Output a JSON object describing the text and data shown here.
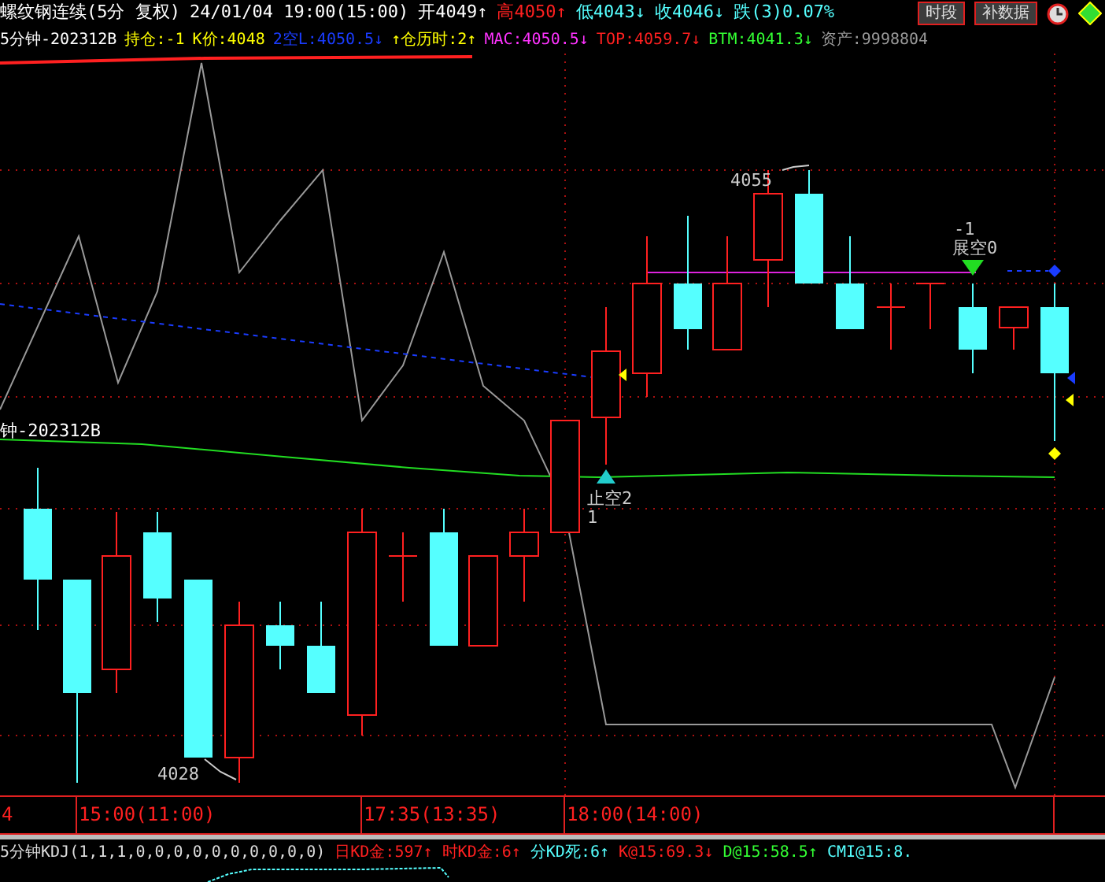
{
  "header": {
    "title": "螺纹钢连续(5分 复权)",
    "datetime": "24/01/04 19:00(15:00)",
    "quotes": [
      {
        "text": "开4049↑",
        "color": "#ffffff"
      },
      {
        "text": "高4050↑",
        "color": "#ff2020"
      },
      {
        "text": "低4043↓",
        "color": "#55ffff"
      },
      {
        "text": "收4046↓",
        "color": "#55ffff"
      },
      {
        "text": "跌(3)0.07%",
        "color": "#55ffff"
      }
    ],
    "buttons": [
      {
        "label": "时段"
      },
      {
        "label": "补数据"
      }
    ]
  },
  "indicators": [
    {
      "text": "5分钟-202312B",
      "color": "#ffffff"
    },
    {
      "text": "持仓:-1",
      "color": "#ffff00"
    },
    {
      "text": "K价:4048",
      "color": "#ffff00"
    },
    {
      "text": "2空L:4050.5↓",
      "color": "#1a3cff"
    },
    {
      "text": "↑仓历时:2↑",
      "color": "#ffff00"
    },
    {
      "text": "MAC:4050.5↓",
      "color": "#ff33ff"
    },
    {
      "text": "TOP:4059.7↓",
      "color": "#ff2020"
    },
    {
      "text": "BTM:4041.3↓",
      "color": "#33ff33"
    },
    {
      "text": "资产:9998804",
      "color": "#9a9a9a"
    }
  ],
  "chart_labels": {
    "contract": "钟-202312B",
    "high": "4055",
    "low": "4028",
    "signal_top_count": "-1",
    "signal_top": "展空0",
    "signal_bottom": "止空2",
    "signal_bottom_count": "1"
  },
  "time_axis": [
    "4",
    "15:00(11:00)",
    "17:35(13:35)",
    "18:00(14:00)"
  ],
  "kdj": {
    "title": "5分钟KDJ(1,1,1,0,0,0,0,0,0,0,0,0,0)",
    "values": [
      {
        "text": "日KD金:597↑",
        "color": "#ff2020"
      },
      {
        "text": "时KD金:6↑",
        "color": "#ff2020"
      },
      {
        "text": "分KD死:6↑",
        "color": "#55ffff"
      },
      {
        "text": "K@15:69.3↓",
        "color": "#ff2020"
      },
      {
        "text": "D@15:58.5↑",
        "color": "#33ff33"
      },
      {
        "text": "CMI@15:8.",
        "color": "#55ffff"
      }
    ]
  }
}
